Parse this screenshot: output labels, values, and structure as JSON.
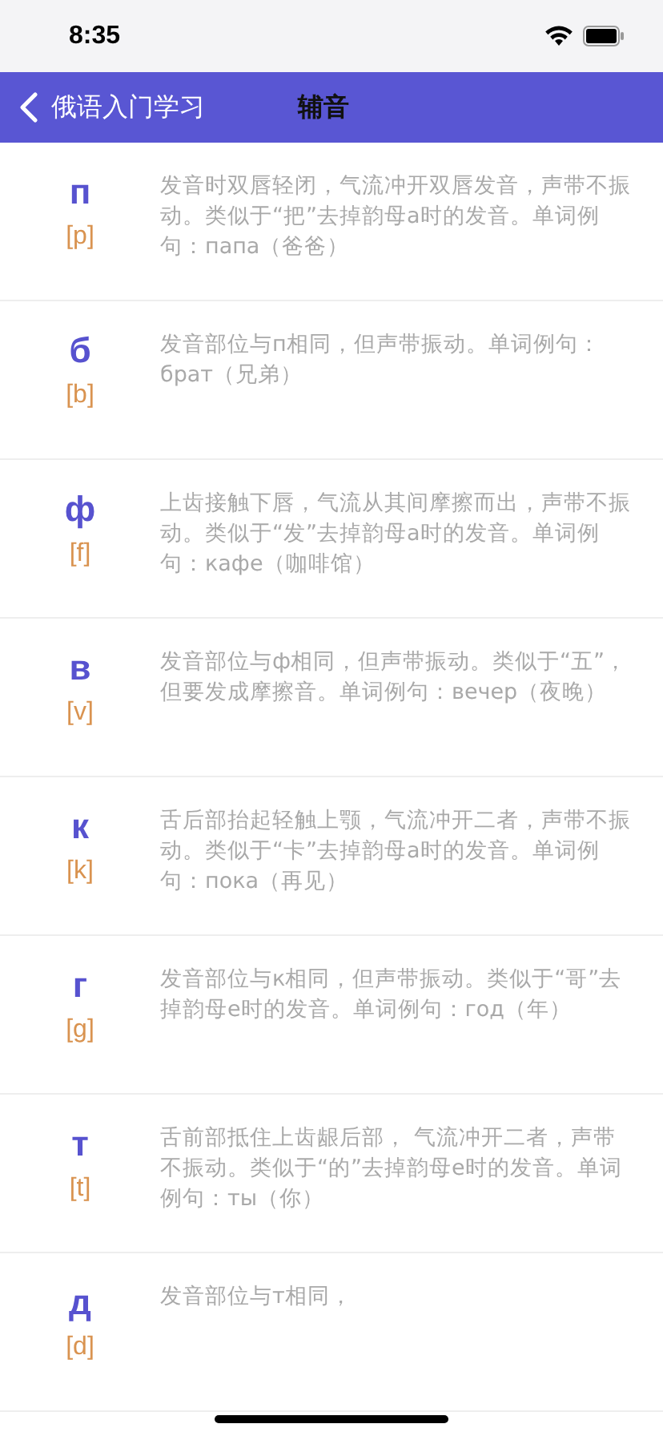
{
  "status_bar": {
    "time": "8:35"
  },
  "nav_bar": {
    "back_label": "俄语入门学习",
    "title": "辅音"
  },
  "consonants": [
    {
      "letter": "п",
      "ipa": "[p]",
      "description": "发音时双唇轻闭，气流冲开双唇发音，声带不振动。类似于“把”去掉韵母a时的发音。单词例句：папа（爸爸）"
    },
    {
      "letter": "б",
      "ipa": "[b]",
      "description": "发音部位与п相同，但声带振动。单词例句：брат（兄弟）"
    },
    {
      "letter": "ф",
      "ipa": "[f]",
      "description": "上齿接触下唇，气流从其间摩擦而出，声带不振动。类似于“发”去掉韵母a时的发音。单词例句：кафе（咖啡馆）"
    },
    {
      "letter": "в",
      "ipa": "[v]",
      "description": "发音部位与ф相同，但声带振动。类似于“五”，但要发成摩擦音。单词例句：вечер（夜晚）"
    },
    {
      "letter": "к",
      "ipa": "[k]",
      "description": "舌后部抬起轻触上颚，气流冲开二者，声带不振动。类似于“卡”去掉韵母a时的发音。单词例句：пока（再见）"
    },
    {
      "letter": "г",
      "ipa": "[g]",
      "description": "发音部位与к相同，但声带振动。类似于“哥”去掉韵母e时的发音。单词例句：год（年）"
    },
    {
      "letter": "т",
      "ipa": "[t]",
      "description": "舌前部抵住上齿龈后部， 气流冲开二者，声带不振动。类似于“的”去掉韵母e时的发音。单词例句：ты（你）"
    },
    {
      "letter": "д",
      "ipa": "[d]",
      "description": "发音部位与т相同，"
    }
  ]
}
